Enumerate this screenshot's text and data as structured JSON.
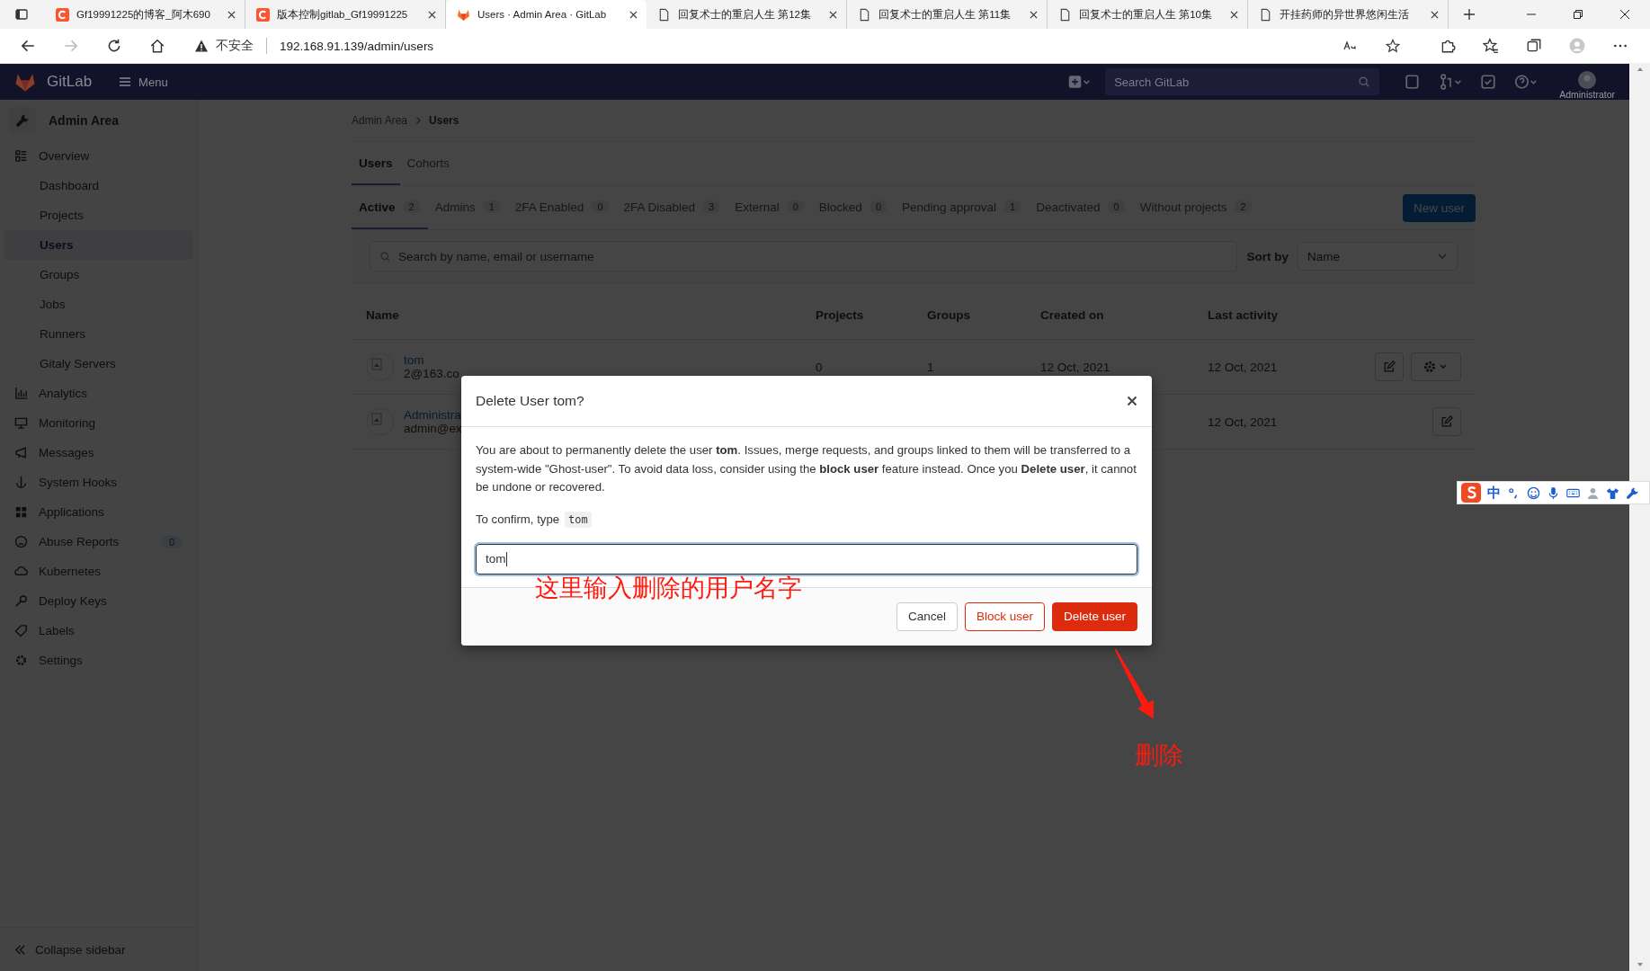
{
  "browser": {
    "tabs": [
      {
        "title": "Gf19991225的博客_阿木690",
        "kind": "csdn",
        "selected": false
      },
      {
        "title": "版本控制gitlab_Gf19991225",
        "kind": "csdn",
        "selected": false
      },
      {
        "title": "Users · Admin Area · GitLab",
        "kind": "gitlab",
        "selected": true
      },
      {
        "title": "回复术士的重启人生 第12集",
        "kind": "page",
        "selected": false
      },
      {
        "title": "回复术士的重启人生 第11集",
        "kind": "page",
        "selected": false
      },
      {
        "title": "回复术士的重启人生 第10集",
        "kind": "page",
        "selected": false
      },
      {
        "title": "开挂药师的异世界悠闲生活",
        "kind": "page",
        "selected": false
      }
    ],
    "security": "不安全",
    "url": "192.168.91.139/admin/users"
  },
  "navbar": {
    "brand": "GitLab",
    "menu": "Menu",
    "search_placeholder": "Search GitLab",
    "user": "Administrator"
  },
  "sidebar": {
    "header": "Admin Area",
    "items": [
      {
        "label": "Overview",
        "selected": false,
        "expanded": true,
        "children": [
          {
            "label": "Dashboard",
            "selected": false
          },
          {
            "label": "Projects",
            "selected": false
          },
          {
            "label": "Users",
            "selected": true
          },
          {
            "label": "Groups",
            "selected": false
          },
          {
            "label": "Jobs",
            "selected": false
          },
          {
            "label": "Runners",
            "selected": false
          },
          {
            "label": "Gitaly Servers",
            "selected": false
          }
        ]
      },
      {
        "label": "Analytics",
        "selected": false
      },
      {
        "label": "Monitoring",
        "selected": false
      },
      {
        "label": "Messages",
        "selected": false
      },
      {
        "label": "System Hooks",
        "selected": false
      },
      {
        "label": "Applications",
        "selected": false
      },
      {
        "label": "Abuse Reports",
        "selected": false,
        "badge": "0"
      },
      {
        "label": "Kubernetes",
        "selected": false
      },
      {
        "label": "Deploy Keys",
        "selected": false
      },
      {
        "label": "Labels",
        "selected": false
      },
      {
        "label": "Settings",
        "selected": false
      }
    ],
    "collapse": "Collapse sidebar"
  },
  "breadcrumb": [
    "Admin Area",
    "Users"
  ],
  "page_tabs": [
    {
      "label": "Users",
      "selected": true
    },
    {
      "label": "Cohorts",
      "selected": false
    }
  ],
  "filters": [
    {
      "label": "Active",
      "count": "2",
      "selected": true
    },
    {
      "label": "Admins",
      "count": "1",
      "selected": false
    },
    {
      "label": "2FA Enabled",
      "count": "0",
      "selected": false
    },
    {
      "label": "2FA Disabled",
      "count": "3",
      "selected": false
    },
    {
      "label": "External",
      "count": "0",
      "selected": false
    },
    {
      "label": "Blocked",
      "count": "0",
      "selected": false
    },
    {
      "label": "Pending approval",
      "count": "1",
      "selected": false
    },
    {
      "label": "Deactivated",
      "count": "0",
      "selected": false
    },
    {
      "label": "Without projects",
      "count": "2",
      "selected": false
    }
  ],
  "new_user_button": "New user",
  "search": {
    "placeholder": "Search by name, email or username"
  },
  "sort": {
    "label": "Sort by",
    "value": "Name"
  },
  "table": {
    "columns": [
      "Name",
      "Projects",
      "Groups",
      "Created on",
      "Last activity"
    ],
    "rows": [
      {
        "name": "tom",
        "email": "2@163.co",
        "projects": "0",
        "groups": "1",
        "created": "12 Oct, 2021",
        "last_activity": "12 Oct, 2021",
        "settings_menu": true
      },
      {
        "name": "Administra",
        "email": "admin@ex",
        "last_activity": "12 Oct, 2021",
        "settings_menu": false
      }
    ]
  },
  "modal": {
    "title": "Delete User tom?",
    "body": "You are about to permanently delete the user **tom**. Issues, merge requests, and groups linked to them will be transferred to a system-wide \"Ghost-user\". To avoid data loss, consider using the **block user** feature instead. Once you **Delete user**, it cannot be undone or recovered.",
    "confirm_label": "To confirm, type",
    "confirm_code": "tom",
    "input_value": "tom",
    "buttons": [
      {
        "label": "Cancel",
        "kind": "default"
      },
      {
        "label": "Block user",
        "kind": "outline-danger"
      },
      {
        "label": "Delete user",
        "kind": "danger"
      }
    ]
  },
  "annotations": {
    "input_note": "这里输入删除的用户名字",
    "button_note": "删除"
  },
  "ime_toolbar": {
    "mode": "中"
  }
}
